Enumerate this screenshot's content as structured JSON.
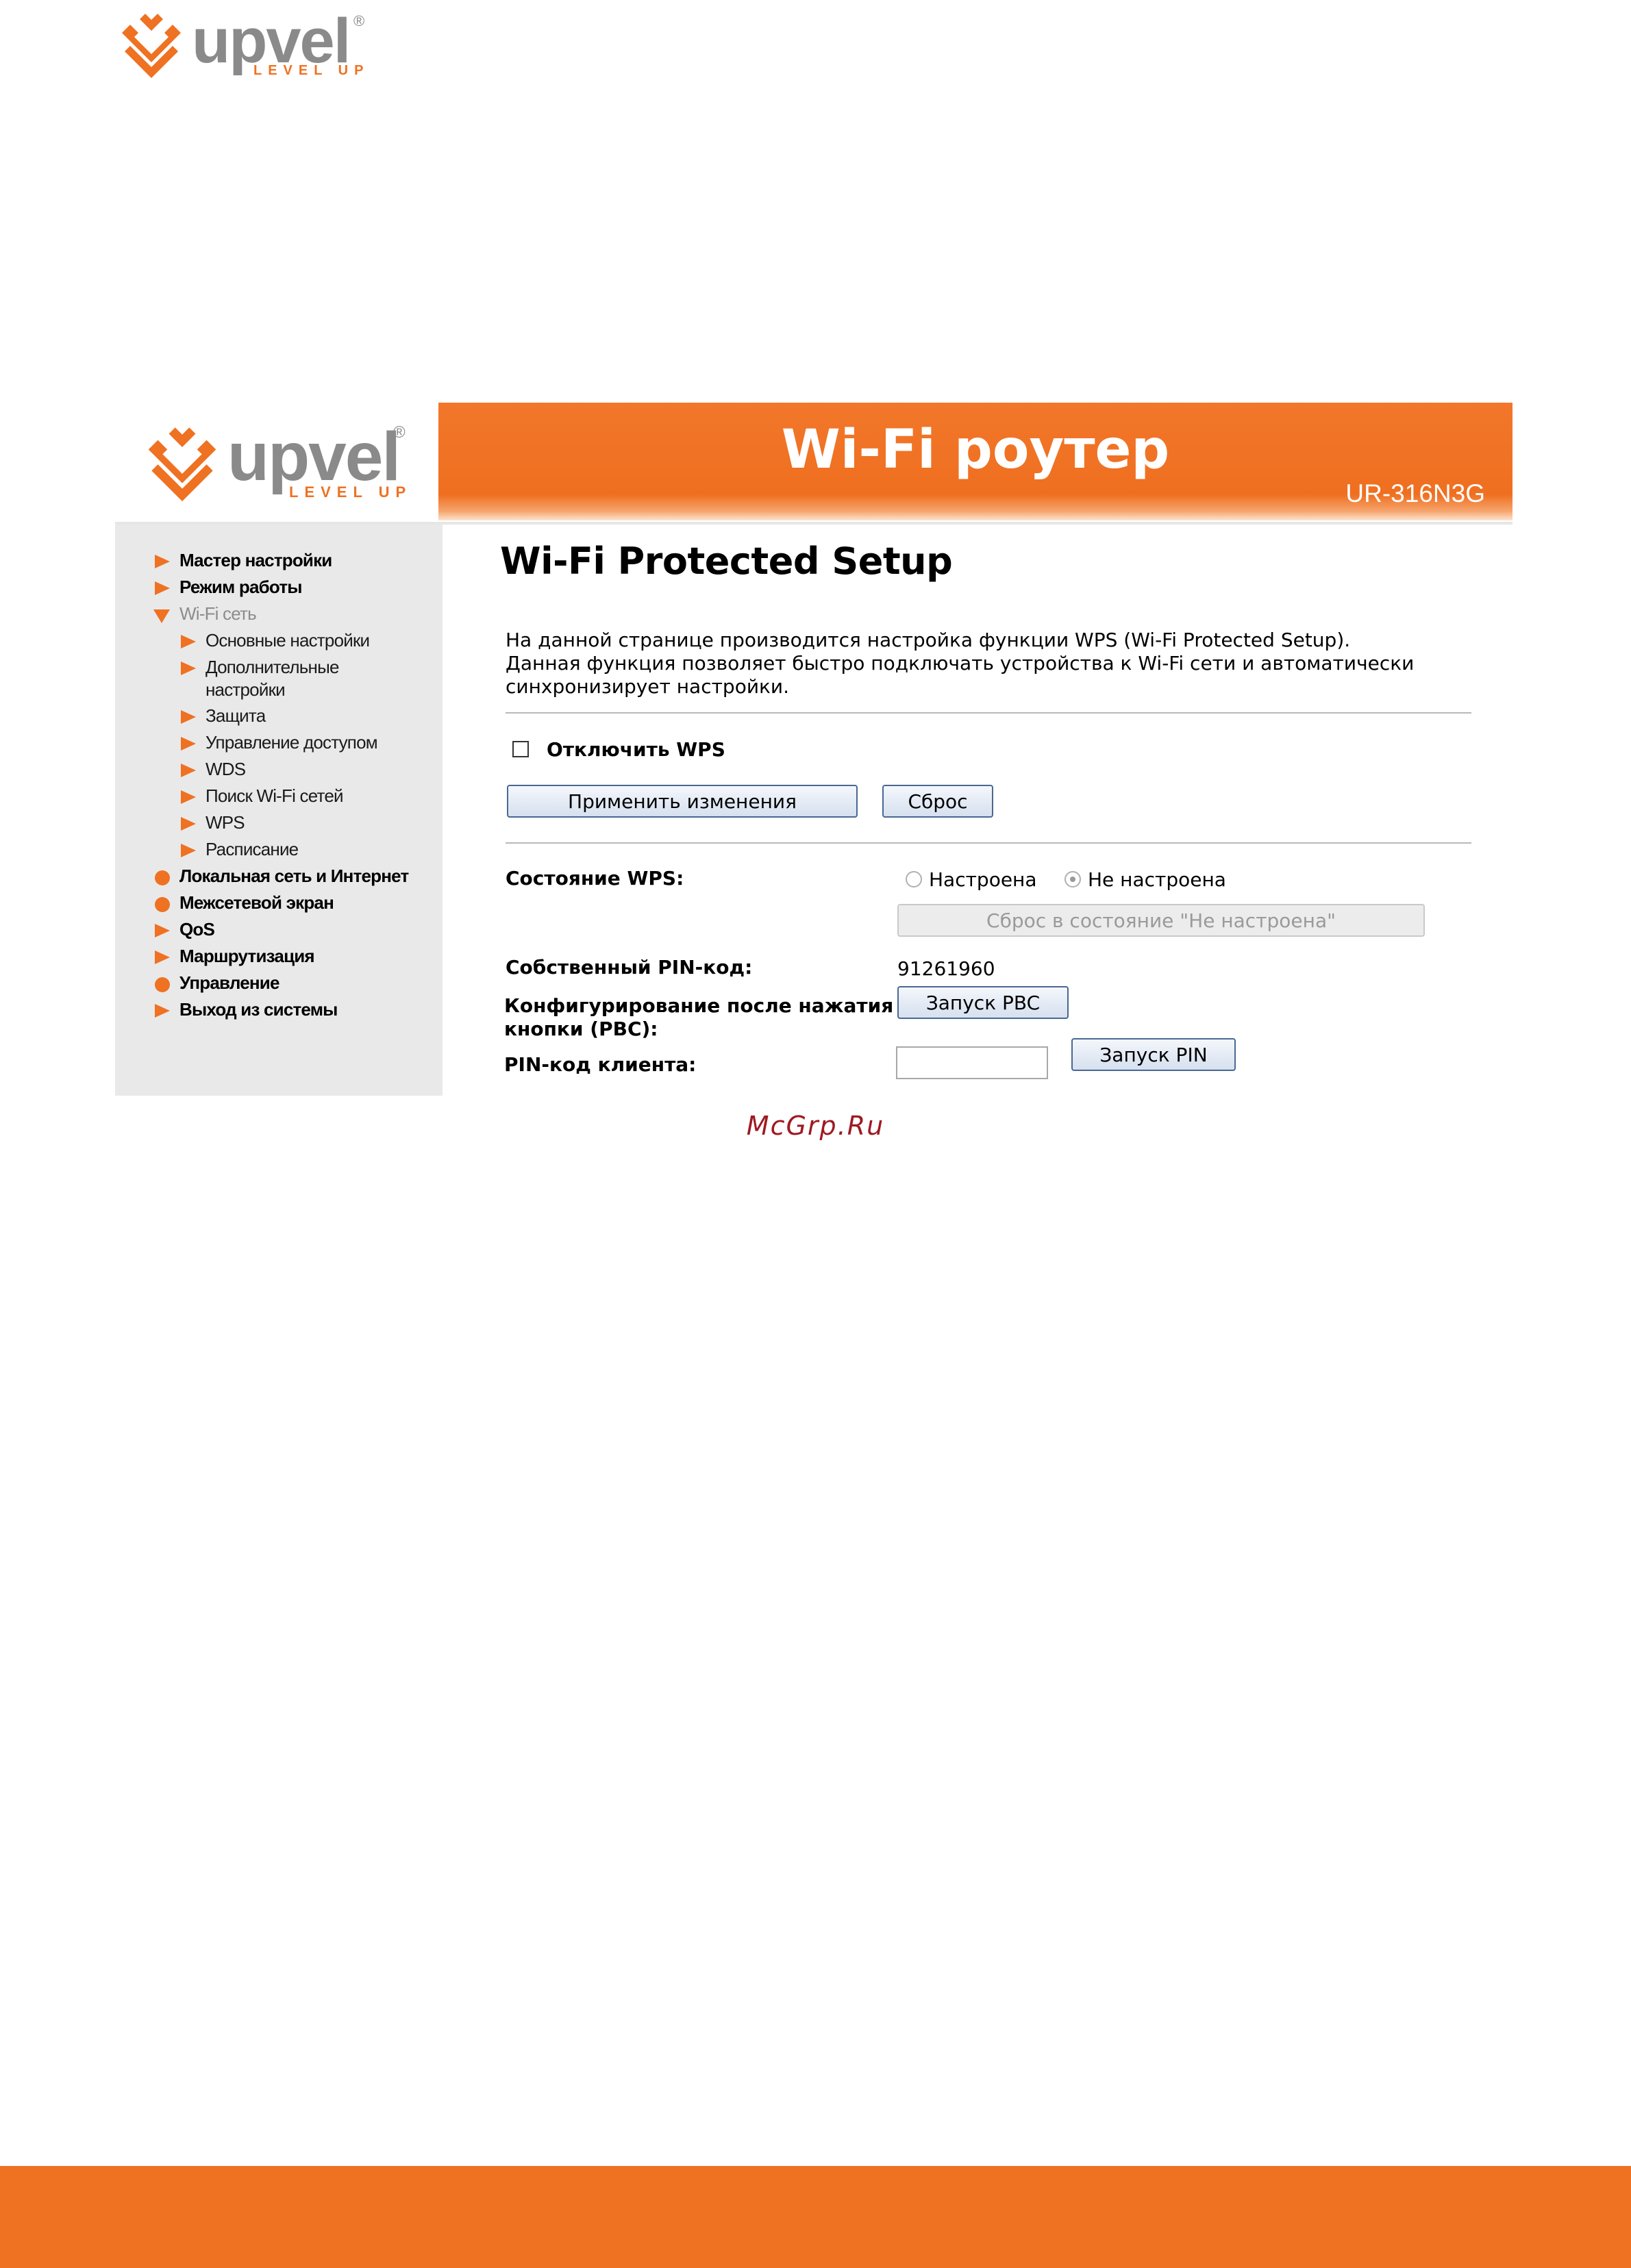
{
  "brand": {
    "name": "upvel",
    "tagline": "LEVEL UP",
    "registered": "®",
    "color": "#ef7122"
  },
  "header": {
    "title": "Wi-Fi роутер",
    "model": "UR-316N3G"
  },
  "sidebar": {
    "items": [
      {
        "label": "Мастер настройки",
        "marker": "triangle-right-icon"
      },
      {
        "label": "Режим работы",
        "marker": "triangle-right-icon"
      },
      {
        "label": "Wi-Fi сеть",
        "marker": "triangle-down-icon"
      },
      {
        "label": "Основные настройки",
        "marker": "triangle-right-icon"
      },
      {
        "label": "Дополнительные",
        "label2": "настройки",
        "marker": "triangle-right-icon"
      },
      {
        "label": "Защита",
        "marker": "triangle-right-icon"
      },
      {
        "label": "Управление доступом",
        "marker": "triangle-right-icon"
      },
      {
        "label": "WDS",
        "marker": "triangle-right-icon"
      },
      {
        "label": "Поиск Wi-Fi сетей",
        "marker": "triangle-right-icon"
      },
      {
        "label": "WPS",
        "marker": "triangle-right-icon"
      },
      {
        "label": "Расписание",
        "marker": "triangle-right-icon"
      },
      {
        "label": "Локальная сеть и Интернет",
        "marker": "dot-icon"
      },
      {
        "label": "Межсетевой экран",
        "marker": "dot-icon"
      },
      {
        "label": "QoS",
        "marker": "triangle-right-icon"
      },
      {
        "label": "Маршрутизация",
        "marker": "triangle-right-icon"
      },
      {
        "label": "Управление",
        "marker": "dot-icon"
      },
      {
        "label": "Выход из системы",
        "marker": "triangle-right-icon"
      }
    ]
  },
  "main": {
    "title": "Wi-Fi Protected Setup",
    "description": [
      "На данной странице производится настройка функции WPS (Wi-Fi Protected Setup).",
      "Данная функция позволяет быстро подключать устройства к Wi-Fi сети и автоматически",
      "синхронизирует настройки."
    ],
    "disable_wps": {
      "label": "Отключить WPS",
      "checked": false
    },
    "apply_label": "Применить изменения",
    "reset_label": "Сброс",
    "wps_status": {
      "label": "Состояние WPS:",
      "option_configured": "Настроена",
      "option_not_configured": "Не настроена",
      "selected": "Не настроена",
      "reset_button": "Сброс в состояние \"Не настроена\""
    },
    "own_pin": {
      "label": "Собственный PIN-код:",
      "value": "91261960"
    },
    "pbc": {
      "label_line1": "Конфигурирование после нажатия",
      "label_line2": "кнопки (PBC):",
      "button": "Запуск PBC"
    },
    "client_pin": {
      "label": "PIN-код клиента:",
      "value": "",
      "button": "Запуск PIN"
    }
  },
  "watermark": "McGrp.Ru"
}
